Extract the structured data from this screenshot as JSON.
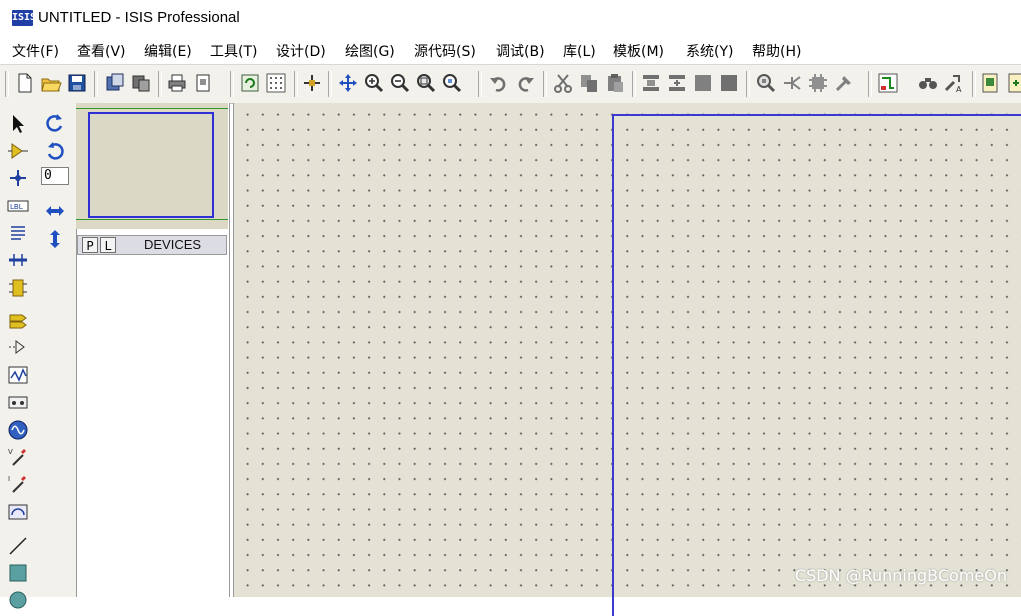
{
  "window": {
    "title": "UNTITLED - ISIS Professional",
    "logo_text": "ISIS"
  },
  "menu": [
    {
      "label": "文件(F)"
    },
    {
      "label": "查看(V)"
    },
    {
      "label": "编辑(E)"
    },
    {
      "label": "工具(T)"
    },
    {
      "label": "设计(D)"
    },
    {
      "label": "绘图(G)"
    },
    {
      "label": "源代码(S)"
    },
    {
      "label": "调试(B)"
    },
    {
      "label": "库(L)"
    },
    {
      "label": "模板(M)"
    },
    {
      "label": "系统(Y)"
    },
    {
      "label": "帮助(H)"
    }
  ],
  "rotate_panel": {
    "angle_value": "0"
  },
  "devices_panel": {
    "pick_label": "P",
    "library_label": "L",
    "title": "DEVICES"
  },
  "canvas": {
    "background": "#e4e2d4",
    "sheet_border_color": "#3a3ad0"
  },
  "watermark": "CSDN @RunningBComeOn"
}
